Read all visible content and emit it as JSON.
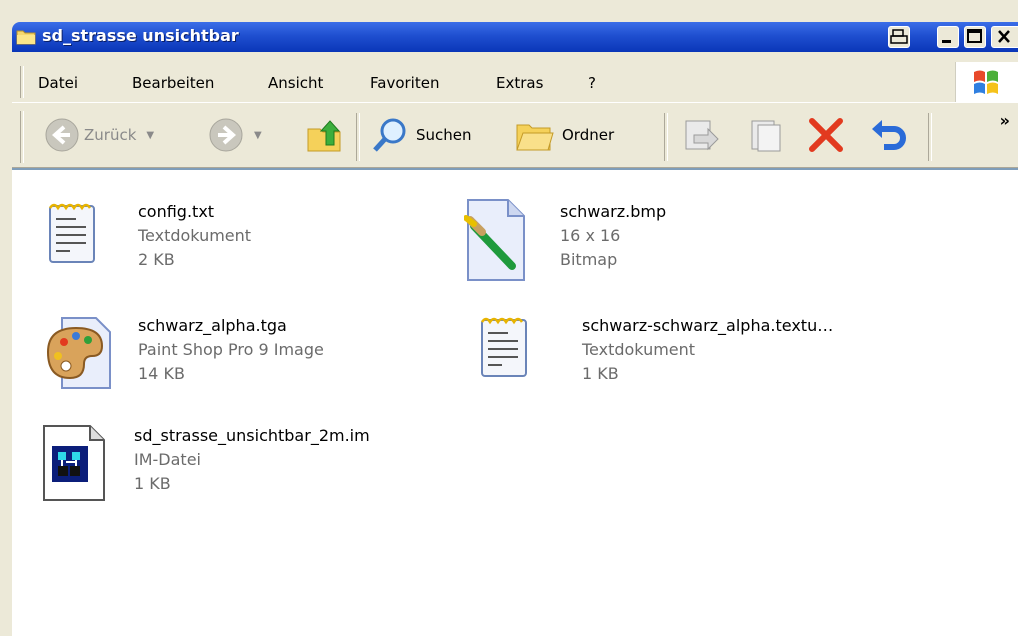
{
  "window": {
    "title": "sd_strasse unsichtbar"
  },
  "menu": [
    "Datei",
    "Bearbeiten",
    "Ansicht",
    "Favoriten",
    "Extras",
    "?"
  ],
  "toolbar": {
    "back_label": "Zurück",
    "search_label": "Suchen",
    "folders_label": "Ordner",
    "more_glyph": "»"
  },
  "files": [
    {
      "name": "config.txt",
      "type": "Textdokument",
      "size": "2 KB",
      "icon": "text-document-icon"
    },
    {
      "name": "schwarz.bmp",
      "type": "16 x 16",
      "size": "Bitmap",
      "icon": "bitmap-paint-icon"
    },
    {
      "name": "schwarz_alpha.tga",
      "type": "Paint Shop Pro 9 Image",
      "size": "14 KB",
      "icon": "paint-palette-icon"
    },
    {
      "name": "schwarz-schwarz_alpha.textu…",
      "type": "Textdokument",
      "size": "1 KB",
      "icon": "text-document-icon"
    },
    {
      "name": "sd_strasse_unsichtbar_2m.im",
      "type": "IM-Datei",
      "size": "1 KB",
      "icon": "im-file-icon"
    }
  ]
}
